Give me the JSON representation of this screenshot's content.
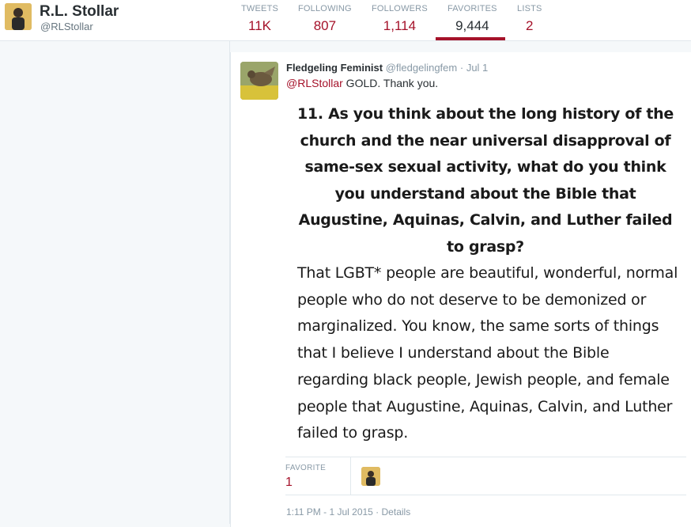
{
  "profile": {
    "name": "R.L. Stollar",
    "handle": "@RLStollar"
  },
  "stats": [
    {
      "label": "TWEETS",
      "value": "11K"
    },
    {
      "label": "FOLLOWING",
      "value": "807"
    },
    {
      "label": "FOLLOWERS",
      "value": "1,114"
    },
    {
      "label": "FAVORITES",
      "value": "9,444"
    },
    {
      "label": "LISTS",
      "value": "2"
    }
  ],
  "tweet": {
    "author_name": "Fledgeling Feminist",
    "author_handle": "@fledgelingfem",
    "separator": "·",
    "date": "Jul 1",
    "mention": "@RLStollar",
    "text": " GOLD. Thank you.",
    "quote_question": "11. As you think about the long history of the church and the near universal disapproval of same-sex sexual activity, what do you think you understand about the Bible that Augustine, Aquinas, Calvin, and Luther failed to grasp?",
    "quote_answer": "That LGBT* people are beautiful, wonderful, normal people who do not deserve to be demonized or marginalized. You know, the same sorts of things that I believe I understand about the Bible regarding black people, Jewish people, and female people that Augustine, Aquinas, Calvin, and Luther failed to grasp.",
    "favorite_label": "FAVORITE",
    "favorite_count": "1",
    "timestamp": "1:11 PM - 1 Jul 2015",
    "details_separator": " · ",
    "details_label": "Details"
  },
  "colors": {
    "accent": "#a5122a",
    "muted": "#8899a6",
    "border": "#e1e8ed"
  }
}
